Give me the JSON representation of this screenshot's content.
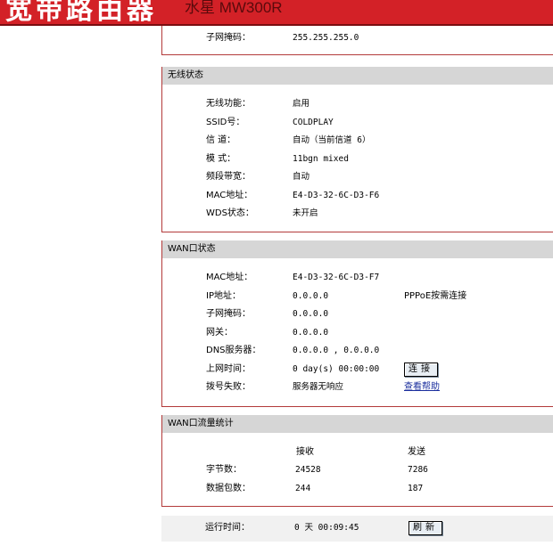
{
  "header": {
    "title": "宽带路由器",
    "model": "水星 MW300R"
  },
  "lan_partial": {
    "subnet_label": "子网掩码：",
    "subnet_value": "255.255.255.0"
  },
  "wireless": {
    "title": "无线状态",
    "rows": [
      {
        "label": "无线功能：",
        "value": "启用"
      },
      {
        "label": "SSID号：",
        "value": "COLDPLAY"
      },
      {
        "label": "信  道：",
        "value": "自动（当前信道 6）"
      },
      {
        "label": "模  式：",
        "value": "11bgn mixed"
      },
      {
        "label": "频段带宽：",
        "value": "自动"
      },
      {
        "label": "MAC地址：",
        "value": "E4-D3-32-6C-D3-F6"
      },
      {
        "label": "WDS状态：",
        "value": "未开启"
      }
    ]
  },
  "wan": {
    "title": "WAN口状态",
    "rows": [
      {
        "label": "MAC地址：",
        "value": "E4-D3-32-6C-D3-F7"
      },
      {
        "label": "IP地址：",
        "value": "0.0.0.0",
        "extra": "PPPoE按需连接"
      },
      {
        "label": "子网掩码：",
        "value": "0.0.0.0"
      },
      {
        "label": "网关：",
        "value": "0.0.0.0"
      },
      {
        "label": "DNS服务器：",
        "value": "0.0.0.0 , 0.0.0.0"
      },
      {
        "label": "上网时间：",
        "value": "0 day(s) 00:00:00"
      },
      {
        "label": "拨号失败：",
        "value": "服务器无响应"
      }
    ],
    "connect_button": "连接",
    "help_link": "查看帮助"
  },
  "traffic": {
    "title": "WAN口流量统计",
    "col_recv": "接收",
    "col_send": "发送",
    "rows": [
      {
        "label": "字节数：",
        "recv": "24528",
        "send": "7286"
      },
      {
        "label": "数据包数：",
        "recv": "244",
        "send": "187"
      }
    ]
  },
  "uptime": {
    "label": "运行时间：",
    "value": "0 天 00:09:45",
    "refresh_button": "刷新"
  }
}
